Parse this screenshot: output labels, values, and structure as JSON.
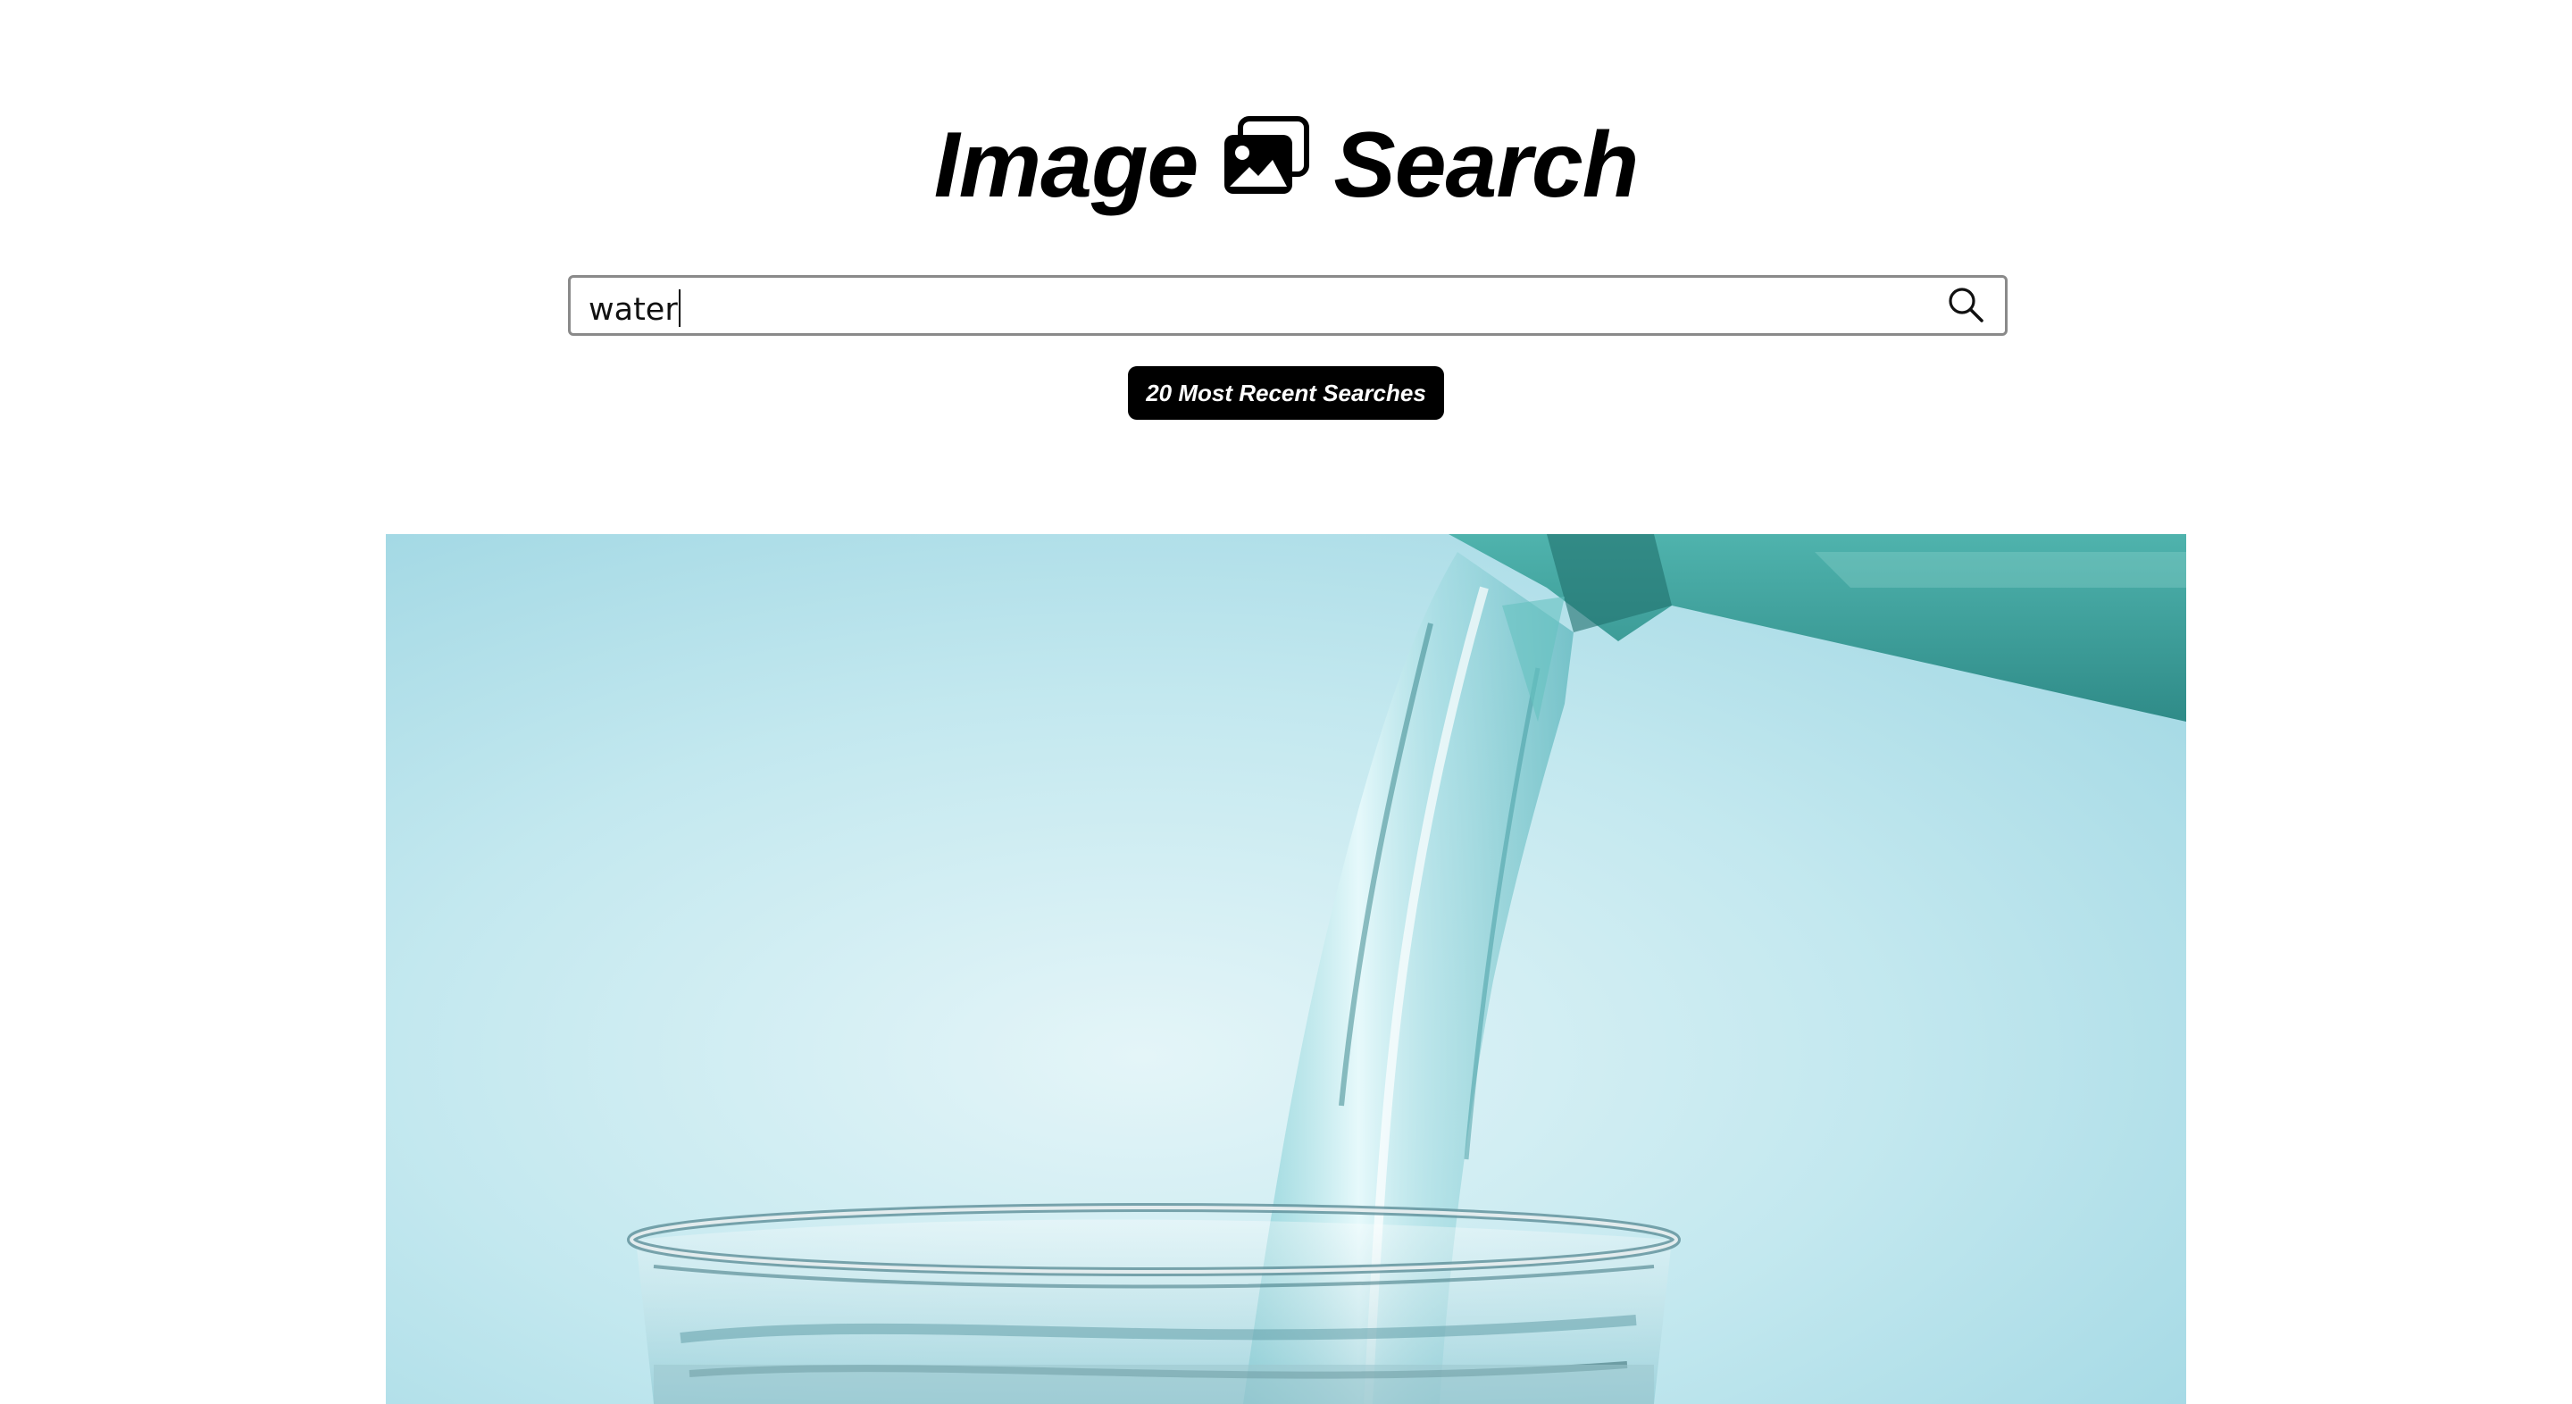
{
  "header": {
    "title_word_1": "Image",
    "title_icon": "images-icon",
    "title_word_2": "Search"
  },
  "search": {
    "value": "water",
    "button_icon": "search-icon"
  },
  "recent_button": {
    "label": "20 Most Recent Searches"
  },
  "result": {
    "subject": "water pouring into glass",
    "colors": {
      "background": "#a9dbe6",
      "glow": "#e4f5f8",
      "bottle": "#3e9a96"
    }
  }
}
